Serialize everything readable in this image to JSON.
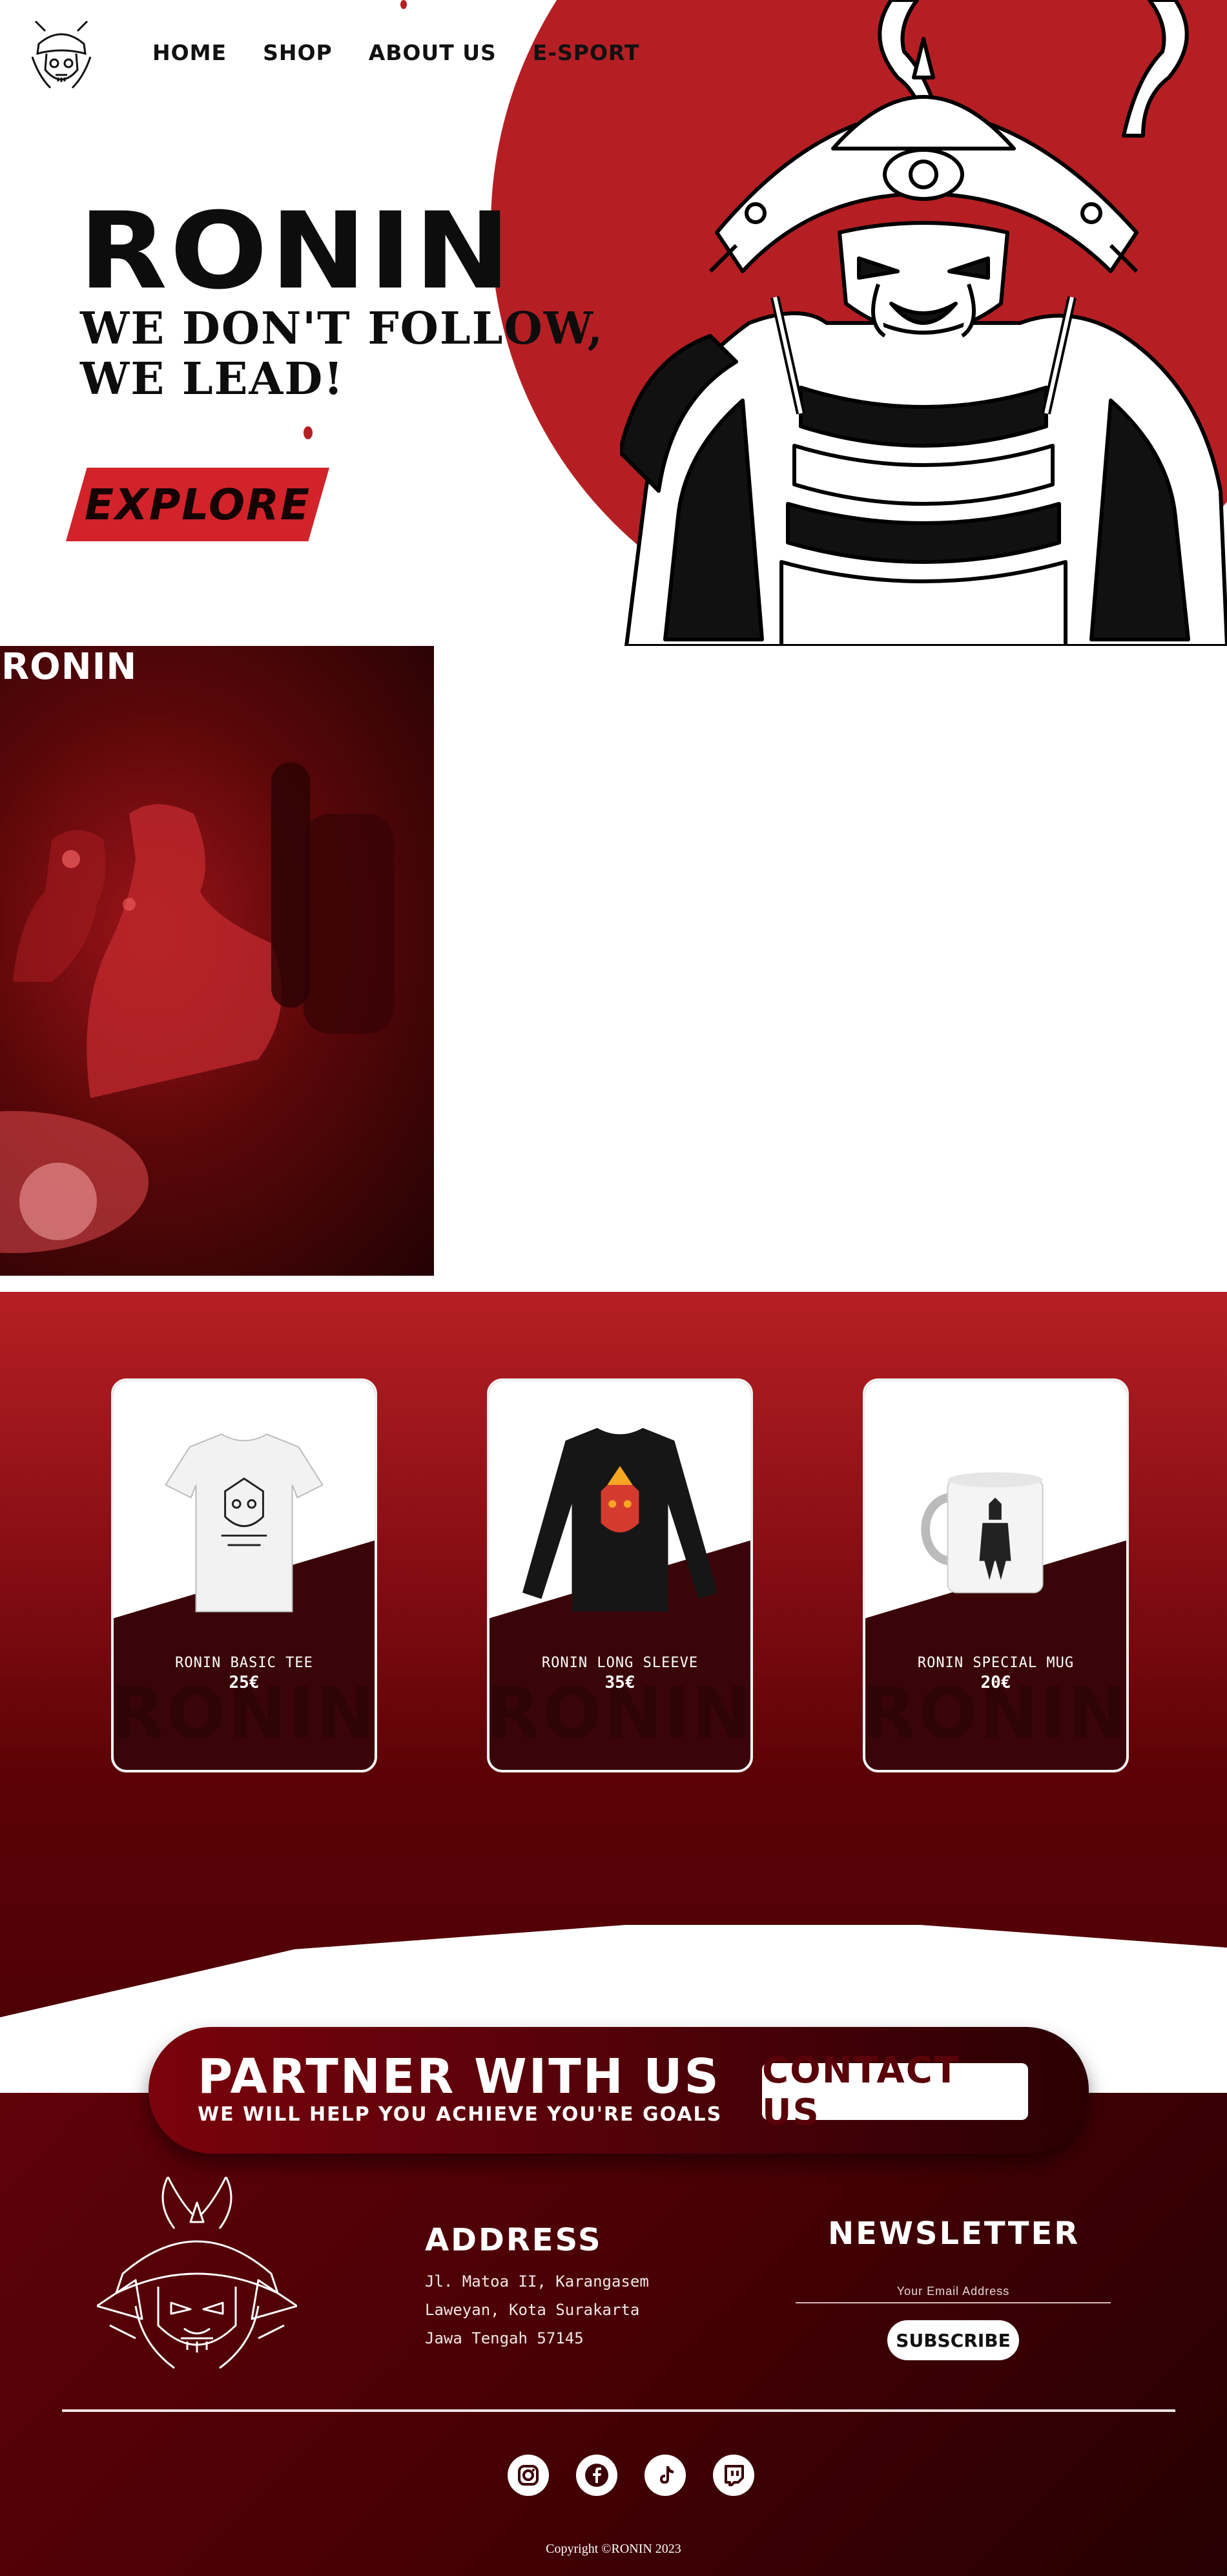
{
  "nav": {
    "items": [
      {
        "label": "HOME"
      },
      {
        "label": "SHOP"
      },
      {
        "label": "ABOUT US"
      },
      {
        "label": "E-SPORT"
      }
    ]
  },
  "hero": {
    "title": "RONIN",
    "tagline_line1": "WE DON'T FOLLOW,",
    "tagline_line2": "WE LEAD!",
    "explore_label": "EXPLORE"
  },
  "gallery": {
    "brand": "RONIN"
  },
  "shop": {
    "products": [
      {
        "name": "RONIN BASIC TEE",
        "price": "25€",
        "watermark": "RONIN"
      },
      {
        "name": "RONIN LONG SLEEVE",
        "price": "35€",
        "watermark": "RONIN"
      },
      {
        "name": "RONIN SPECIAL MUG",
        "price": "20€",
        "watermark": "RONIN"
      }
    ]
  },
  "partner": {
    "title": "PARTNER WITH US",
    "subtitle": "WE WILL HELP YOU ACHIEVE YOU'RE GOALS",
    "contact_label": "CONTACT US"
  },
  "footer": {
    "address_title": "ADDRESS",
    "address_lines": [
      "Jl. Matoa II, Karangasem",
      "Laweyan, Kota Surakarta",
      "Jawa Tengah 57145"
    ],
    "newsletter_title": "NEWSLETTER",
    "email_placeholder": "Your Email Address",
    "subscribe_label": "SUBSCRIBE",
    "socials": [
      "instagram-icon",
      "facebook-icon",
      "tiktok-icon",
      "twitch-icon"
    ],
    "copyright": "Copyright ©RONIN 2023"
  },
  "colors": {
    "accent_red": "#b51f24",
    "dark_maroon": "#4a0005",
    "white": "#ffffff"
  }
}
